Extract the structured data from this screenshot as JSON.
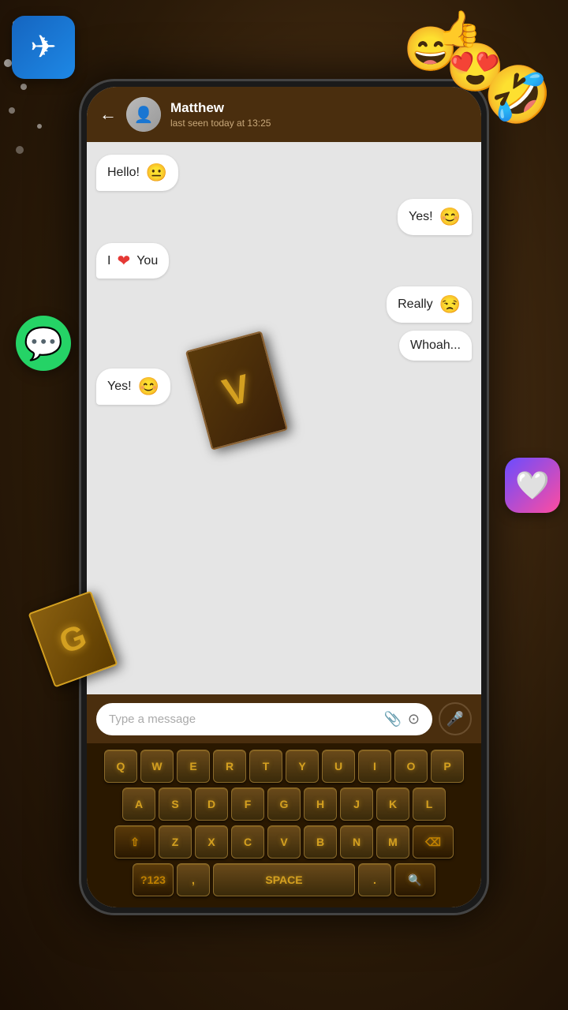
{
  "header": {
    "back_label": "←",
    "contact_name": "Matthew",
    "contact_status": "last seen today at 13:25",
    "avatar_icon": "👤"
  },
  "messages": [
    {
      "id": 1,
      "type": "received",
      "text": "Hello!",
      "emoji": "😐"
    },
    {
      "id": 2,
      "type": "sent",
      "text": "Yes!",
      "emoji": "😊"
    },
    {
      "id": 3,
      "type": "received",
      "text": "I",
      "heart": "❤",
      "text2": "You"
    },
    {
      "id": 4,
      "type": "sent",
      "text": "Really",
      "emoji": "😒"
    },
    {
      "id": 5,
      "type": "sent",
      "text": "Whoah...",
      "emoji": ""
    },
    {
      "id": 6,
      "type": "received",
      "text": "Yes!",
      "emoji": "😊"
    }
  ],
  "input": {
    "placeholder": "Type a message",
    "attach_icon": "📎",
    "camera_icon": "⊙",
    "mic_icon": "🎤"
  },
  "keyboard": {
    "rows": [
      [
        "Q",
        "W",
        "E",
        "R",
        "T",
        "Y",
        "U",
        "I",
        "O",
        "P"
      ],
      [
        "A",
        "S",
        "D",
        "F",
        "G",
        "H",
        "J",
        "K",
        "L"
      ],
      [
        "⇧",
        "Z",
        "X",
        "C",
        "V",
        "B",
        "N",
        "M",
        "⌫"
      ],
      [
        "?123",
        ",",
        "SPACE",
        ".",
        "🔍"
      ]
    ]
  },
  "decorations": {
    "book_letter": "V",
    "book_gold_letter": "G",
    "flying_emojis": [
      "😍",
      "🤣",
      "😄"
    ],
    "fb_like": "👍"
  }
}
